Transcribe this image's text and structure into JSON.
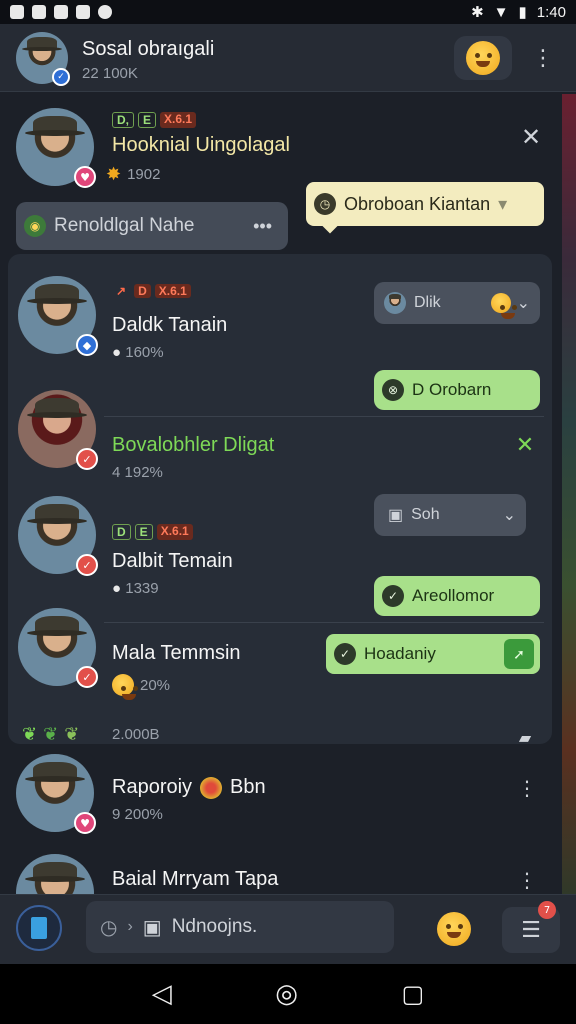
{
  "status_bar": {
    "time": "1:40"
  },
  "header": {
    "name": "Sosal obraıgali",
    "subtitle": "22 100K"
  },
  "featured": {
    "tags": [
      "D,",
      "E",
      "X.6.1"
    ],
    "name": "Hooknial Uingolagal",
    "stat": "1902",
    "bubble_label": "Obroboan Kiantan",
    "dropdown_label": "Renoldlgal Nahe"
  },
  "contacts": [
    {
      "tags": [
        "",
        "D",
        "X.6.1"
      ],
      "name": "Daldk Tanain",
      "stat": "160%",
      "bubble_top": "Dlik",
      "action_label": "D Orobarn"
    },
    {
      "name": "Bovalobhler Dligat",
      "stat": "4 192%"
    },
    {
      "tags": [
        "D",
        "E",
        "X.6.1"
      ],
      "name": "Dalbit Temain",
      "stat": "1339",
      "bubble_top": "Soh",
      "action_label": "Areollomor"
    },
    {
      "name": "Mala Temmsin",
      "stat": "20%",
      "action_label": "Hoadaniy"
    }
  ],
  "card_footer": {
    "count": "2.000B"
  },
  "list_more": [
    {
      "name": "Raporoiy",
      "name_suffix": "Bbn",
      "stat": "9 200%"
    },
    {
      "name": "Baial Mrryam Tapa"
    }
  ],
  "bottom_bar": {
    "input_placeholder": "Ndnoojns.",
    "notif_count": "7"
  },
  "colors": {
    "bg": "#1c2028",
    "card": "#272d37",
    "accent_green": "#a8e08a",
    "accent_cream": "#f3ecbf",
    "badge_red": "#e2504a"
  }
}
